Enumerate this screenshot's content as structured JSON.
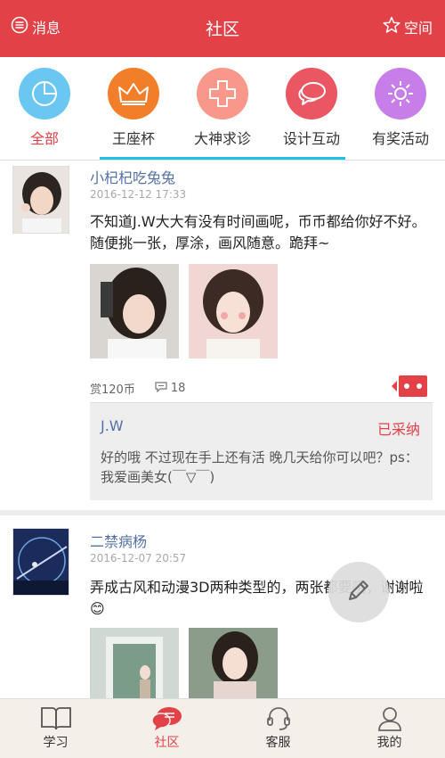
{
  "header": {
    "left_label": "消息",
    "title": "社区",
    "right_label": "空间"
  },
  "categories": [
    {
      "label": "全部",
      "color": "#69c7f2",
      "icon": "pie-icon",
      "active": true
    },
    {
      "label": "王座杯",
      "color": "#f27e2a",
      "icon": "crown-icon",
      "active": false
    },
    {
      "label": "大神求诊",
      "color": "#f7988a",
      "icon": "cross-icon",
      "active": false
    },
    {
      "label": "设计互动",
      "color": "#ea5662",
      "icon": "chat-icon",
      "active": false
    },
    {
      "label": "有奖活动",
      "color": "#c77ee8",
      "icon": "sun-icon",
      "active": false
    }
  ],
  "posts": [
    {
      "author": "小杞杞吃兔兔",
      "time": "2016-12-12 17:33",
      "content": "不知道J.W大大有没有时间画呢，币币都给你好不好。随便挑一张，厚涂，画风随意。跪拜~",
      "reward": "赏120币",
      "comments": "18",
      "reply": {
        "name": "J.W",
        "status": "已采纳",
        "text": "好的哦 不过现在手上还有活 晚几天给你可以吧？ps：我爱画美女(￣▽￣)"
      }
    },
    {
      "author": "二禁病杨",
      "time": "2016-12-07 20:57",
      "content": "弄成古风和动漫3D两种类型的，两张都要哦，谢谢啦😊"
    }
  ],
  "bottom_nav": [
    {
      "label": "学习",
      "icon": "book-icon",
      "active": false
    },
    {
      "label": "社区",
      "icon": "chat-bubble-icon",
      "active": true
    },
    {
      "label": "客服",
      "icon": "headset-icon",
      "active": false
    },
    {
      "label": "我的",
      "icon": "person-icon",
      "active": false
    }
  ],
  "colors": {
    "brand": "#e14147",
    "link": "#5470a5",
    "tab_underline": "#1ac3e4"
  }
}
